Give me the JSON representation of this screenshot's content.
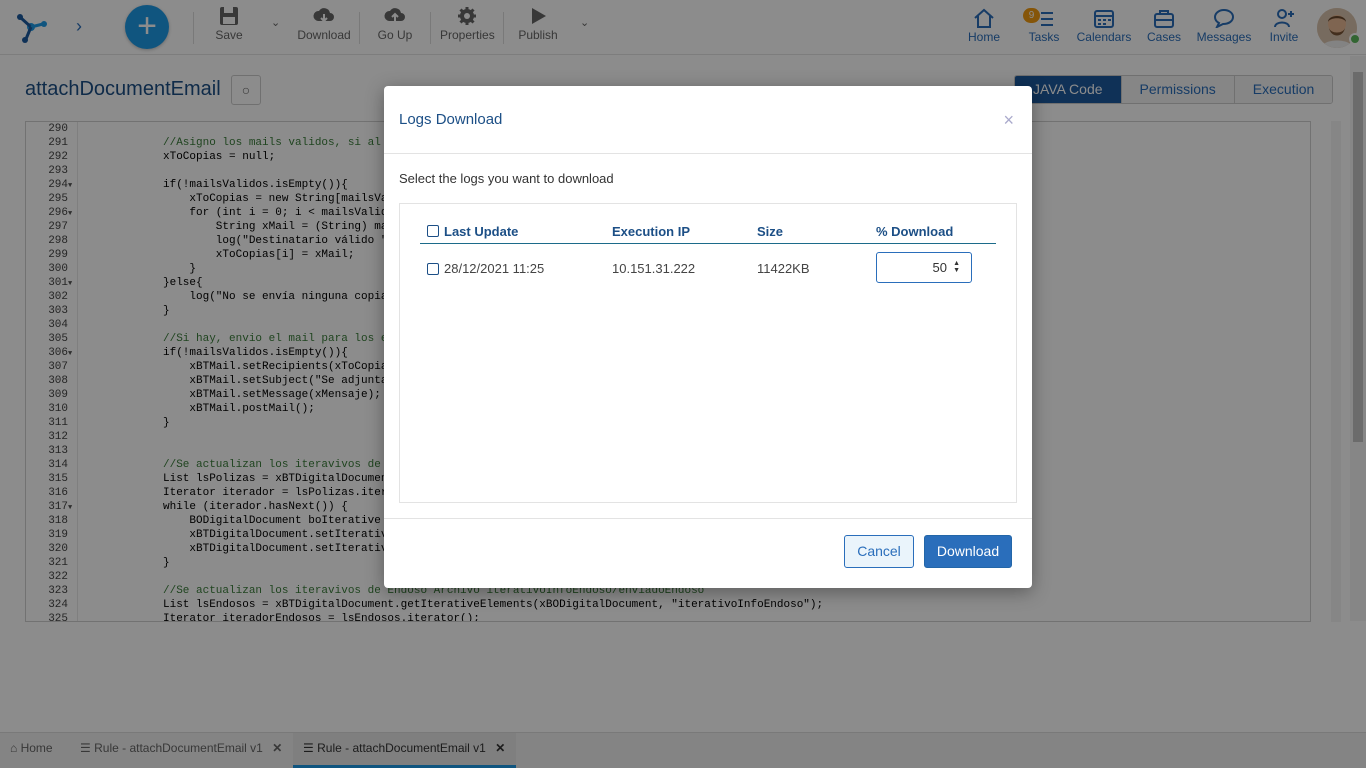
{
  "toolbar": {
    "save": "Save",
    "download": "Download",
    "go_up": "Go Up",
    "properties": "Properties",
    "publish": "Publish"
  },
  "nav": {
    "home": "Home",
    "tasks": "Tasks",
    "tasks_badge": "9",
    "calendars": "Calendars",
    "cases": "Cases",
    "messages": "Messages",
    "invite": "Invite"
  },
  "page": {
    "title": "attachDocumentEmail",
    "tabs": [
      "JAVA Code",
      "Permissions",
      "Execution"
    ]
  },
  "code": [
    {
      "n": "290",
      "fold": "",
      "t": ""
    },
    {
      "n": "291",
      "fold": "",
      "t": "//Asigno los mails validos, si al"
    },
    {
      "n": "292",
      "fold": "",
      "t": "xToCopias = null;"
    },
    {
      "n": "293",
      "fold": "",
      "t": ""
    },
    {
      "n": "294",
      "fold": "▼",
      "t": "if(!mailsValidos.isEmpty()){"
    },
    {
      "n": "295",
      "fold": "",
      "t": "    xToCopias = new String[mailsVa"
    },
    {
      "n": "296",
      "fold": "▼",
      "t": "    for (int i = 0; i < mailsValid"
    },
    {
      "n": "297",
      "fold": "",
      "t": "        String xMail = (String) ma"
    },
    {
      "n": "298",
      "fold": "",
      "t": "        log(\"Destinatario válido \""
    },
    {
      "n": "299",
      "fold": "",
      "t": "        xToCopias[i] = xMail;"
    },
    {
      "n": "300",
      "fold": "",
      "t": "    }"
    },
    {
      "n": "301",
      "fold": "▼",
      "t": "}else{"
    },
    {
      "n": "302",
      "fold": "",
      "t": "    log(\"No se envía ninguna copia"
    },
    {
      "n": "303",
      "fold": "",
      "t": "}"
    },
    {
      "n": "304",
      "fold": "",
      "t": ""
    },
    {
      "n": "305",
      "fold": "",
      "t": "//Si hay, envio el mail para los e"
    },
    {
      "n": "306",
      "fold": "▼",
      "t": "if(!mailsValidos.isEmpty()){"
    },
    {
      "n": "307",
      "fold": "",
      "t": "    xBTMail.setRecipients(xToCopia"
    },
    {
      "n": "308",
      "fold": "",
      "t": "    xBTMail.setSubject(\"Se adjunta"
    },
    {
      "n": "309",
      "fold": "",
      "t": "    xBTMail.setMessage(xMensaje);"
    },
    {
      "n": "310",
      "fold": "",
      "t": "    xBTMail.postMail();"
    },
    {
      "n": "311",
      "fold": "",
      "t": "}"
    },
    {
      "n": "312",
      "fold": "",
      "t": ""
    },
    {
      "n": "313",
      "fold": "",
      "t": ""
    },
    {
      "n": "314",
      "fold": "",
      "t": "//Se actualizan los iteravivos de"
    },
    {
      "n": "315",
      "fold": "",
      "t": "List lsPolizas = xBTDigitalDocumen"
    },
    {
      "n": "316",
      "fold": "",
      "t": "Iterator iterador = lsPolizas.iter"
    },
    {
      "n": "317",
      "fold": "▼",
      "t": "while (iterador.hasNext()) {"
    },
    {
      "n": "318",
      "fold": "",
      "t": "    BODigitalDocument boIterative "
    },
    {
      "n": "319",
      "fold": "",
      "t": "    xBTDigitalDocument.setIterativ"
    },
    {
      "n": "320",
      "fold": "",
      "t": "    xBTDigitalDocument.setIterativ"
    },
    {
      "n": "321",
      "fold": "",
      "t": "}"
    },
    {
      "n": "322",
      "fold": "",
      "t": ""
    },
    {
      "n": "323",
      "fold": "",
      "t": "//Se actualizan los iteravivos de Endoso Archivo iterativoInfoEndoso/enviadoEndoso"
    },
    {
      "n": "324",
      "fold": "",
      "t": "List lsEndosos = xBTDigitalDocument.getIterativeElements(xBODigitalDocument, \"iterativoInfoEndoso\");"
    },
    {
      "n": "325",
      "fold": "",
      "t": "Iterator iteradorEndosos = lsEndosos.iterator();"
    }
  ],
  "bottom_tabs": {
    "home": "Home",
    "tab1": "Rule - attachDocumentEmail v1",
    "tab2": "Rule - attachDocumentEmail v1"
  },
  "modal": {
    "title": "Logs Download",
    "close": "×",
    "subtitle": "Select the logs you want to download",
    "columns": {
      "last_update": "Last Update",
      "execution_ip": "Execution IP",
      "size": "Size",
      "percent": "% Download"
    },
    "row": {
      "last_update": "28/12/2021 11:25",
      "execution_ip": "10.151.31.222",
      "size": "11422KB",
      "percent": "50"
    },
    "cancel": "Cancel",
    "download": "Download"
  }
}
